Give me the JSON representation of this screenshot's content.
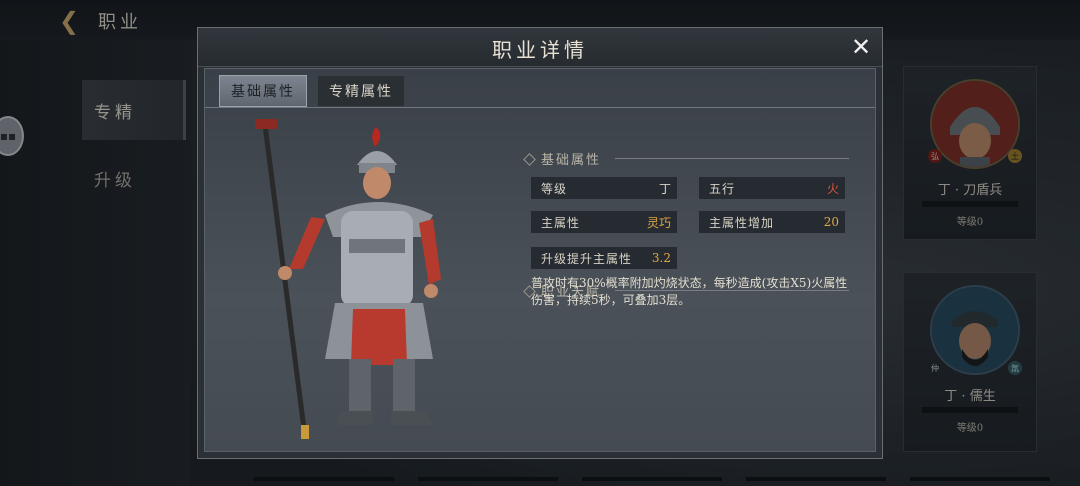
{
  "header": {
    "back_icon": "back-arrow-icon",
    "title": "职业"
  },
  "sidebar": {
    "tabs": [
      {
        "label": "专精"
      },
      {
        "label": "升级"
      }
    ]
  },
  "cards": [
    {
      "name": "丁 · 刀盾兵",
      "level": "等级0",
      "badge_left": "弘",
      "badge_right": "土"
    },
    {
      "name": "丁 · 儒生",
      "level": "等级0",
      "badge_left": "仲",
      "badge_right": "氚"
    }
  ],
  "modal": {
    "title": "职业详情",
    "close_icon": "close-icon",
    "tabs": [
      {
        "label": "基础属性"
      },
      {
        "label": "专精属性"
      }
    ],
    "basic_section_title": "基础属性",
    "attributes": [
      {
        "label": "等级",
        "value": "丁"
      },
      {
        "label": "五行",
        "value": "火"
      },
      {
        "label": "主属性",
        "value": "灵巧"
      },
      {
        "label": "主属性增加",
        "value": "20"
      },
      {
        "label": "升级提升主属性",
        "value": "3.2"
      }
    ],
    "talent_section_title": "职业天赋",
    "talent_text": "普攻时有30%概率附加灼烧状态，每秒造成(攻击X5)火属性伤害，持续5秒，可叠加3层。"
  },
  "colors": {
    "fire": "#e0533c",
    "gold": "#e0a742"
  }
}
